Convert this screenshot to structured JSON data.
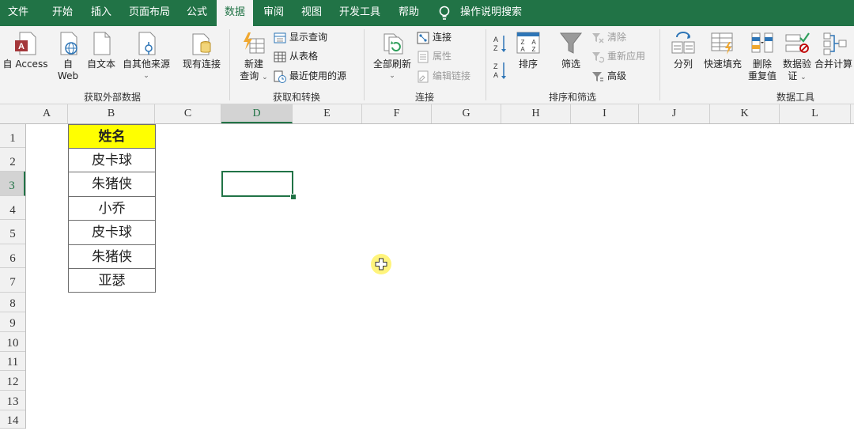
{
  "tabs": [
    "文件",
    "开始",
    "插入",
    "页面布局",
    "公式",
    "数据",
    "审阅",
    "视图",
    "开发工具",
    "帮助"
  ],
  "active_tab": "数据",
  "tell_me": "操作说明搜索",
  "ribbon": {
    "get_external": {
      "label": "获取外部数据",
      "access": "自 Access",
      "web_l1": "自",
      "web_l2": "Web",
      "text": "自文本",
      "other": "自其他来源",
      "existing": "现有连接"
    },
    "get_transform": {
      "label": "获取和转换",
      "new_query_l1": "新建",
      "new_query_l2": "查询",
      "show_queries": "显示查询",
      "from_table": "从表格",
      "recent_sources": "最近使用的源"
    },
    "connections": {
      "label": "连接",
      "refresh_all": "全部刷新",
      "connections": "连接",
      "properties": "属性",
      "edit_links": "编辑链接"
    },
    "sort_filter": {
      "label": "排序和筛选",
      "sort": "排序",
      "filter": "筛选",
      "clear": "清除",
      "reapply": "重新应用",
      "advanced": "高级"
    },
    "data_tools": {
      "label": "数据工具",
      "text_to_columns": "分列",
      "flash_fill": "快速填充",
      "remove_dup_l1": "删除",
      "remove_dup_l2": "重复值",
      "validation_l1": "数据验",
      "validation_l2": "证",
      "consolidate": "合并计算"
    }
  },
  "columns": [
    "A",
    "B",
    "C",
    "D",
    "E",
    "F",
    "G",
    "H",
    "I",
    "J",
    "K",
    "L"
  ],
  "rows": [
    "1",
    "2",
    "3",
    "4",
    "5",
    "6",
    "7",
    "8",
    "9",
    "10",
    "11",
    "12",
    "13",
    "14"
  ],
  "table": {
    "header": "姓名",
    "values": [
      "皮卡球",
      "朱猪侠",
      "小乔",
      "皮卡球",
      "朱猪侠",
      "亚瑟"
    ]
  },
  "colors": {
    "accent": "#217346",
    "header_fill": "#ffff00",
    "cursor": "#fff050"
  }
}
